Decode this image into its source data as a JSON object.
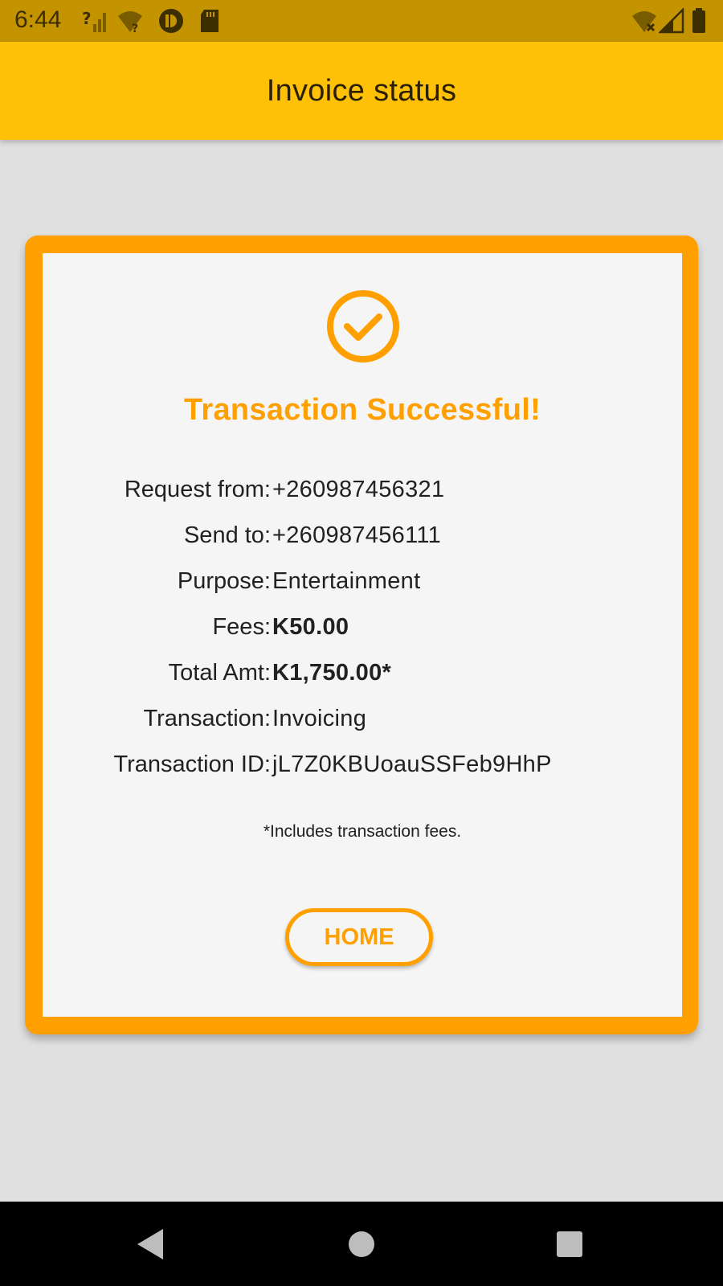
{
  "status_bar": {
    "time": "6:44",
    "icons": [
      "unknown-signal-icon",
      "wifi-question-icon",
      "app-notification-icon",
      "sd-card-icon",
      "wifi-off-icon",
      "cell-signal-icon",
      "battery-icon"
    ]
  },
  "app_bar": {
    "title": "Invoice status"
  },
  "card": {
    "icon": "check-circle-icon",
    "title": "Transaction Successful!",
    "details": [
      {
        "label": "Request from:",
        "value": "+260987456321"
      },
      {
        "label": "Send to:",
        "value": "+260987456111"
      },
      {
        "label": "Purpose:",
        "value": "Entertainment"
      },
      {
        "label": "Fees:",
        "value": "K50.00"
      },
      {
        "label": "Total Amt:",
        "value": "K1,750.00*"
      },
      {
        "label": "Transaction:",
        "value": "Invoicing"
      },
      {
        "label": "Transaction ID:",
        "value": "jL7Z0KBUoauSSFeb9HhP"
      }
    ],
    "footnote": "*Includes transaction fees.",
    "home_button_label": "HOME"
  },
  "colors": {
    "status_bar": "#c39300",
    "app_bar": "#ffc107",
    "accent": "#ffa000",
    "background": "#e0e0e0",
    "card_inner": "#f5f5f5"
  },
  "nav_bar": {
    "buttons": [
      "back-icon",
      "home-circle-icon",
      "recents-icon"
    ]
  }
}
